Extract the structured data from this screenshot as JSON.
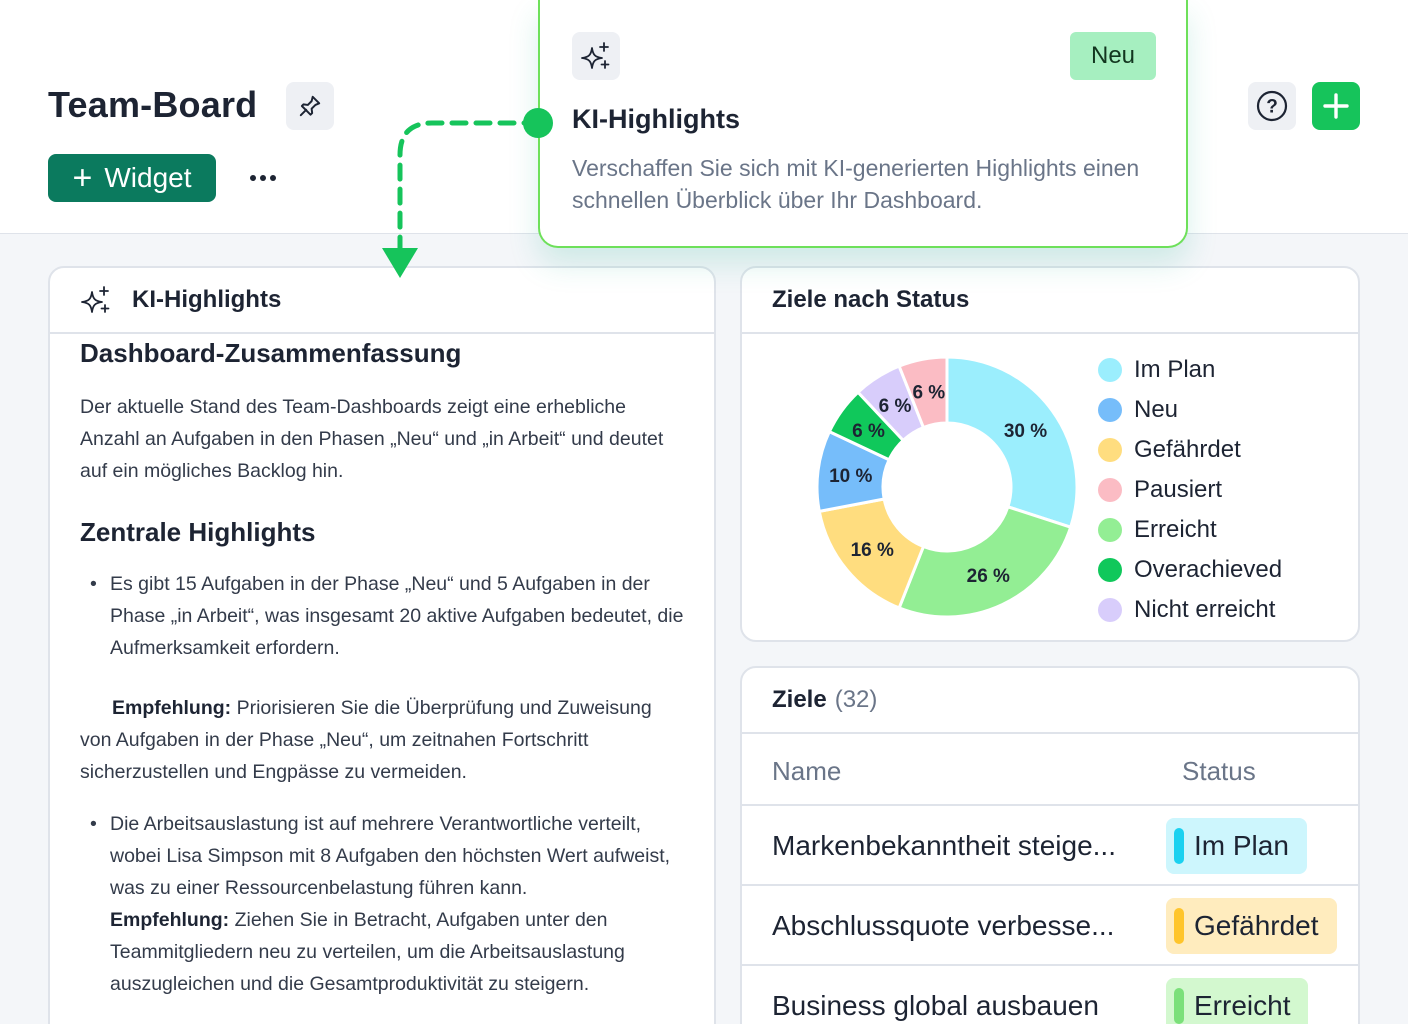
{
  "header": {
    "title": "Team-Board",
    "widget_label": "Widget"
  },
  "popover": {
    "badge": "Neu",
    "title": "KI-Highlights",
    "description": "Verschaffen Sie sich mit KI-generierten Highlights einen schnellen Überblick über Ihr Dashboard."
  },
  "ki_card": {
    "title": "KI-Highlights",
    "summary_heading": "Dashboard-Zusammenfassung",
    "summary_text": "Der aktuelle Stand des Team-Dashboards zeigt eine erhebliche Anzahl an Aufgaben in den Phasen „Neu“ und „in Arbeit“ und deutet auf ein mögliches Backlog hin.",
    "highlights_heading": "Zentrale Highlights",
    "bullet1": "Es gibt 15 Aufgaben in der Phase „Neu“ und 5 Aufgaben in der Phase „in Arbeit“, was insgesamt 20 aktive Aufgaben bedeutet, die Aufmerksamkeit erfordern.",
    "rec_label": "Empfehlung:",
    "rec1_text": " Priorisieren Sie die Überprüfung und Zuweisung von Aufgaben in der Phase „Neu“, um zeitnahen Fortschritt sicherzustellen und Engpässe zu vermeiden.",
    "bullet2": "Die Arbeitsauslastung ist auf mehrere Verantwortliche verteilt, wobei Lisa Simpson mit 8 Aufgaben den höchsten Wert aufweist, was zu einer Ressourcenbelastung führen kann.",
    "rec2_text": " Ziehen Sie in Betracht, Aufgaben unter den Teammitgliedern neu zu verteilen, um die Arbeitsauslastung auszugleichen und die Gesamtproduktivität zu steigern."
  },
  "chart_card": {
    "title": "Ziele nach Status"
  },
  "chart_data": {
    "type": "pie",
    "title": "Ziele nach Status",
    "categories": [
      "Im Plan",
      "Neu",
      "Gefährdet",
      "Pausiert",
      "Erreicht",
      "Overachieved",
      "Nicht erreicht"
    ],
    "legend_order": [
      "Im Plan",
      "Neu",
      "Gefährdet",
      "Pausiert",
      "Erreicht",
      "Overachieved",
      "Nicht erreicht"
    ],
    "slices": [
      {
        "name": "Im Plan",
        "value": 30,
        "label": "30 %",
        "color": "#9beefd"
      },
      {
        "name": "Erreicht",
        "value": 26,
        "label": "26 %",
        "color": "#93ee94"
      },
      {
        "name": "Gefährdet",
        "value": 16,
        "label": "16 %",
        "color": "#ffdd7f"
      },
      {
        "name": "Neu",
        "value": 10,
        "label": "10 %",
        "color": "#76bdfa"
      },
      {
        "name": "Overachieved",
        "value": 6,
        "label": "6 %",
        "color": "#10c85b"
      },
      {
        "name": "Nicht erreicht",
        "value": 6,
        "label": "6 %",
        "color": "#d8cdfb"
      },
      {
        "name": "Pausiert",
        "value": 6,
        "label": "6 %",
        "color": "#fbbcc4"
      }
    ],
    "legend": [
      {
        "name": "Im Plan",
        "color": "#9beefd"
      },
      {
        "name": "Neu",
        "color": "#76bdfa"
      },
      {
        "name": "Gefährdet",
        "color": "#ffdd7f"
      },
      {
        "name": "Pausiert",
        "color": "#fbbcc4"
      },
      {
        "name": "Erreicht",
        "color": "#93ee94"
      },
      {
        "name": "Overachieved",
        "color": "#10c85b"
      },
      {
        "name": "Nicht erreicht",
        "color": "#d8cdfb"
      }
    ],
    "legend_placement": "right"
  },
  "goals": {
    "title": "Ziele",
    "count": "(32)",
    "col_name": "Name",
    "col_status": "Status",
    "rows": [
      {
        "name": "Markenbekanntheit steige...",
        "status": "Im Plan",
        "bg": "#cdf6fd",
        "bar": "#1ad1f0"
      },
      {
        "name": "Abschlussquote verbesse...",
        "status": "Gefährdet",
        "bg": "#ffecbe",
        "bar": "#ffc52b"
      },
      {
        "name": "Business global ausbauen",
        "status": "Erreicht",
        "bg": "#d3f8cf",
        "bar": "#7be07a"
      }
    ]
  },
  "colors": {
    "primary": "#0b7a5e",
    "accent": "#16c45b",
    "popover_border": "#6ee05a"
  }
}
